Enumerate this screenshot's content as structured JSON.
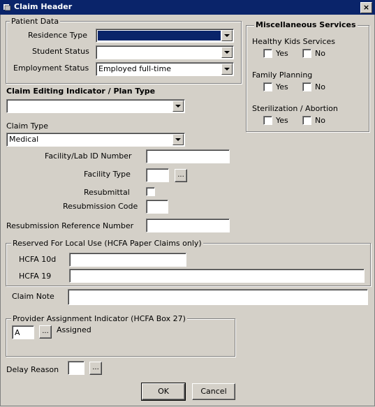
{
  "window": {
    "title": "Claim Header",
    "close_glyph": "×"
  },
  "patient": {
    "legend": "Patient Data",
    "residence_label": "Residence Type",
    "residence_value": "",
    "student_label": "Student Status",
    "student_value": "",
    "employment_label": "Employment Status",
    "employment_value": "Employed full-time"
  },
  "misc": {
    "title": "Miscellaneous Services",
    "sections": [
      {
        "label": "Healthy Kids Services",
        "yes": "Yes",
        "no": "No"
      },
      {
        "label": "Family Planning",
        "yes": "Yes",
        "no": "No"
      },
      {
        "label": "Sterilization / Abortion",
        "yes": "Yes",
        "no": "No"
      }
    ]
  },
  "claim_editing": {
    "label": "Claim Editing Indicator / Plan Type",
    "value": ""
  },
  "claim_type": {
    "label": "Claim Type",
    "value": "Medical"
  },
  "facility_id": {
    "label": "Facility/Lab ID Number",
    "value": ""
  },
  "facility_type": {
    "label": "Facility Type",
    "value": "",
    "button": "..."
  },
  "resubmittal": {
    "label": "Resubmittal"
  },
  "resubmission_code": {
    "label": "Resubmission Code",
    "value": ""
  },
  "resubmission_ref": {
    "label": "Resubmission Reference Number",
    "value": ""
  },
  "local_use": {
    "legend": "Reserved For Local Use (HCFA Paper Claims only)",
    "hcfa10d_label": "HCFA 10d",
    "hcfa10d_value": "",
    "hcfa19_label": "HCFA 19",
    "hcfa19_value": ""
  },
  "claim_note": {
    "label": "Claim Note",
    "value": ""
  },
  "provider": {
    "legend": "Provider Assignment Indicator (HCFA Box 27)",
    "value": "A",
    "button": "...",
    "description": "Assigned"
  },
  "delay": {
    "label": "Delay Reason",
    "value": "",
    "button": "..."
  },
  "buttons": {
    "ok": "OK",
    "cancel": "Cancel"
  }
}
